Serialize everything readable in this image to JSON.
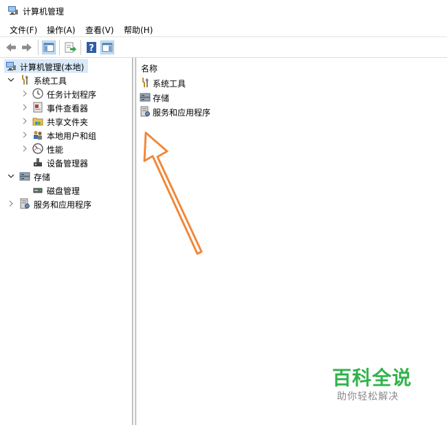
{
  "window": {
    "title": "计算机管理"
  },
  "menu": [
    {
      "label": "文件(F)"
    },
    {
      "label": "操作(A)"
    },
    {
      "label": "查看(V)"
    },
    {
      "label": "帮助(H)"
    }
  ],
  "toolbar": {
    "icons": [
      "back-arrow-icon",
      "forward-arrow-icon",
      "show-hide-tree-icon",
      "export-list-icon",
      "help-icon",
      "action-pane-icon"
    ],
    "pressed": [
      "show-hide-tree-icon",
      "action-pane-icon"
    ]
  },
  "tree": {
    "root": {
      "label": "计算机管理(本地)",
      "selected": true
    },
    "system_tools": {
      "label": "系统工具",
      "expanded": true,
      "children": [
        {
          "label": "任务计划程序"
        },
        {
          "label": "事件查看器"
        },
        {
          "label": "共享文件夹"
        },
        {
          "label": "本地用户和组"
        },
        {
          "label": "性能"
        },
        {
          "label": "设备管理器"
        }
      ]
    },
    "storage": {
      "label": "存储",
      "expanded": true,
      "children": [
        {
          "label": "磁盘管理"
        }
      ]
    },
    "services": {
      "label": "服务和应用程序",
      "expanded": false
    }
  },
  "content": {
    "column_header": "名称",
    "items": [
      {
        "label": "系统工具"
      },
      {
        "label": "存储"
      },
      {
        "label": "服务和应用程序"
      }
    ]
  },
  "watermark": {
    "main": "百科全说",
    "sub": "助你轻松解决"
  },
  "colors": {
    "accent_arrow": "#f0883a",
    "watermark_green": "#31b34a",
    "selection": "#d9e9f9"
  }
}
